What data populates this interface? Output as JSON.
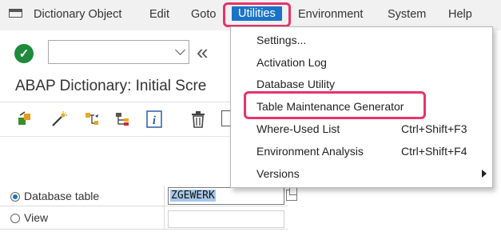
{
  "menubar": {
    "items": [
      {
        "label": "Dictionary Object"
      },
      {
        "label": "Edit"
      },
      {
        "label": "Goto"
      },
      {
        "label": "Utilities"
      },
      {
        "label": "Environment"
      },
      {
        "label": "System"
      },
      {
        "label": "Help"
      }
    ],
    "active_item": "Utilities"
  },
  "toolbar": {
    "command_field_value": "",
    "ok_icon": "check-icon",
    "nav_first_icon": "«"
  },
  "page": {
    "title": "ABAP Dictionary: Initial Scre"
  },
  "app_toolbar": {
    "icons": [
      "other-object-icon",
      "wizard-icon",
      "where-used-icon",
      "hierarchy-icon",
      "info-icon",
      "delete-icon"
    ]
  },
  "form": {
    "options": [
      {
        "label": "Database table",
        "selected": true,
        "value": "ZGEWERK"
      },
      {
        "label": "View",
        "selected": false,
        "value": ""
      }
    ]
  },
  "utilities_menu": {
    "items": [
      {
        "label": "Settings...",
        "shortcut": ""
      },
      {
        "label": "Activation Log",
        "shortcut": ""
      },
      {
        "label": "Database Utility",
        "shortcut": ""
      },
      {
        "label": "Table Maintenance Generator",
        "shortcut": ""
      },
      {
        "label": "Where-Used List",
        "shortcut": "Ctrl+Shift+F3"
      },
      {
        "label": "Environment Analysis",
        "shortcut": "Ctrl+Shift+F4"
      },
      {
        "label": "Versions",
        "shortcut": "",
        "has_submenu": true
      }
    ]
  },
  "colors": {
    "highlight_box": "#e8336b",
    "active_menu": "#1a73c8",
    "ok_button": "#1f8a3b",
    "selection": "#a8c8ea"
  }
}
